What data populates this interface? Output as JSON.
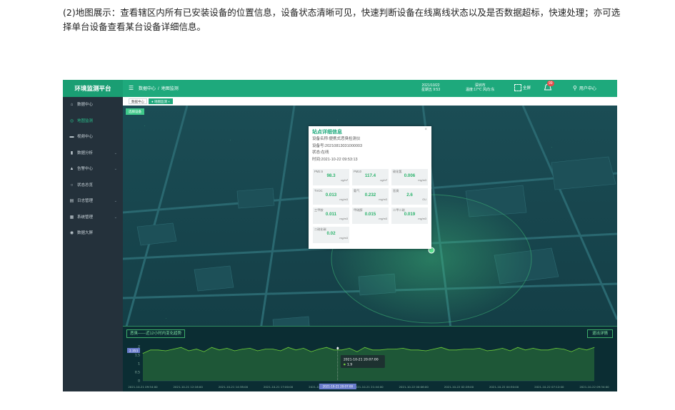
{
  "intro_text": "(2)地图展示：查看辖区内所有已安装设备的位置信息，设备状态清晰可见，快速判断设备在线离线状态以及是否数据超标，快速处理；亦可选择单台设备查看某台设备详细信息。",
  "app": {
    "brand": "环境监测平台",
    "breadcrumb": [
      "数据中心",
      "/",
      "地图监测"
    ],
    "date": "2021/10/22",
    "time": "星期五 9:53",
    "city": "深圳市",
    "weather": "温度:17℃ 风向:东",
    "fullscreen_label": "全屏",
    "notification_count": "99",
    "user_label": "用户中心"
  },
  "sidebar": {
    "items": [
      {
        "label": "数据中心",
        "icon": "home-icon",
        "active": false,
        "has_caret": false
      },
      {
        "label": "地图监测",
        "icon": "map-pin-icon",
        "active": true,
        "has_caret": false
      },
      {
        "label": "视频中心",
        "icon": "video-icon",
        "active": false,
        "has_caret": false
      },
      {
        "label": "数据分析",
        "icon": "bar-chart-icon",
        "active": false,
        "has_caret": true
      },
      {
        "label": "告警中心",
        "icon": "bell-icon",
        "active": false,
        "has_caret": true
      },
      {
        "label": "状态总览",
        "icon": "clock-icon",
        "active": false,
        "has_caret": false
      },
      {
        "label": "日志管理",
        "icon": "log-icon",
        "active": false,
        "has_caret": true
      },
      {
        "label": "系统管理",
        "icon": "gear-icon",
        "active": false,
        "has_caret": true
      },
      {
        "label": "数据大屏",
        "icon": "screen-icon",
        "active": false,
        "has_caret": false
      }
    ]
  },
  "tabs": [
    {
      "label": "数据中心",
      "active": false
    },
    {
      "label": "● 地图监测 ×",
      "active": true
    }
  ],
  "map": {
    "select_button": "选择设备"
  },
  "popup": {
    "title": "站点详细信息",
    "device_name": "设备名称:便携式恶臭检测仪",
    "device_no": "设备号:20210813031000003",
    "status": "状态:在线",
    "time": "时间:2021-10-22 09:53:13",
    "close": "×",
    "cards": [
      {
        "label": "PM2.5",
        "value": "98.3",
        "unit": "ug/m³"
      },
      {
        "label": "PM10",
        "value": "117.4",
        "unit": "ug/m³"
      },
      {
        "label": "硫化氢",
        "value": "0.006",
        "unit": "mg/m3"
      },
      {
        "label": "TVOC",
        "value": "0.013",
        "unit": "mg/m3"
      },
      {
        "label": "氨气",
        "value": "0.232",
        "unit": "mg/m3"
      },
      {
        "label": "恶臭",
        "value": "2.6",
        "unit": "OU"
      },
      {
        "label": "三甲胺",
        "value": "0.011",
        "unit": "mg/m3"
      },
      {
        "label": "甲硫醇",
        "value": "0.015",
        "unit": "mg/m3"
      },
      {
        "label": "二甲二硫",
        "value": "0.019",
        "unit": "mg/m3"
      },
      {
        "label": "二硫化碳",
        "value": "0.02",
        "unit": "mg/m3"
      }
    ]
  },
  "trend": {
    "title": "恶臭——近12小时内变化趋势",
    "exit_button": "退出详情"
  },
  "chart_data": {
    "type": "area",
    "title": "",
    "xlabel": "",
    "ylabel": "",
    "ylim": [
      0,
      2
    ],
    "y_ticks": [
      "2",
      "1.5",
      "1",
      "0.5",
      "0"
    ],
    "x_ticks": [
      "2021-10-21 09:54:00",
      "2021-10-21 12:16:00",
      "2021-10-21 14:38:00",
      "2021-10-21 17:00:00",
      "2021-10-21 19:22:00",
      "2021-10-21 21:44:00",
      "2021-10-22 00:06:00",
      "2021-10-22 02:28:00",
      "2021-10-22 04:50:00",
      "2021-10-22 07:12:00",
      "2021-10-22 09:34:00"
    ],
    "y_marker": "2.353",
    "crosshair_label": "2021-10-21 20:07:00",
    "tooltip": {
      "time": "2021-10-21 20:07:00",
      "value": "1.9"
    },
    "series": [
      {
        "values": [
          1.6,
          1.75,
          1.8,
          1.7,
          1.85,
          1.9,
          1.75,
          1.8,
          1.7,
          1.9,
          1.8,
          1.85,
          1.75,
          1.8,
          1.9,
          1.7,
          1.85,
          1.8,
          1.75,
          1.9,
          1.8,
          1.85,
          1.7,
          1.8,
          1.95,
          1.75,
          1.8,
          1.85,
          1.7,
          1.9,
          1.8,
          1.75,
          1.85,
          1.8,
          1.9,
          1.75,
          1.8,
          1.7,
          1.85,
          1.9,
          1.8,
          1.75,
          1.85,
          1.8,
          1.9,
          1.7,
          1.8,
          1.85,
          1.75,
          1.9,
          1.8,
          1.85,
          1.8,
          1.75,
          1.9,
          1.8,
          1.7,
          1.85,
          1.8,
          1.9
        ]
      }
    ],
    "color": "#6fd03a"
  }
}
